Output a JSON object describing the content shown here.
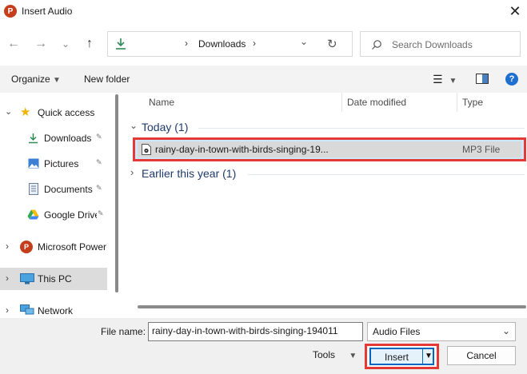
{
  "window": {
    "title": "Insert Audio",
    "app_icon_letter": "P",
    "close_glyph": "✕"
  },
  "nav": {
    "back_glyph": "←",
    "forward_glyph": "→",
    "recent_glyph": "⌄",
    "up_glyph": "↑",
    "breadcrumb_sep": "›",
    "location": "Downloads",
    "location_sep_after": "›",
    "dropdown_glyph": "⌄",
    "refresh_glyph": "↻",
    "search_placeholder": "Search Downloads"
  },
  "toolbar": {
    "organize_label": "Organize",
    "new_folder_label": "New folder",
    "view_glyph": "☰",
    "help_glyph": "?"
  },
  "sidebar": {
    "items": [
      {
        "label": "Quick access",
        "icon": "star-icon",
        "expander": "⌄"
      },
      {
        "label": "Downloads",
        "icon": "download-icon",
        "pin": "📌"
      },
      {
        "label": "Pictures",
        "icon": "pictures-icon",
        "pin": "📌"
      },
      {
        "label": "Documents",
        "icon": "documents-icon",
        "pin": "📌"
      },
      {
        "label": "Google Drive",
        "icon": "google-drive-icon",
        "pin": "📌"
      },
      {
        "label": "Microsoft Power",
        "icon": "powerpoint-icon",
        "expander": "›"
      },
      {
        "label": "This PC",
        "icon": "this-pc-icon",
        "expander": "›"
      },
      {
        "label": "Network",
        "icon": "network-icon",
        "expander": "›"
      }
    ]
  },
  "list": {
    "columns": [
      "Name",
      "Date modified",
      "Type"
    ],
    "groups": [
      {
        "label": "Today (1)",
        "expander": "⌄"
      },
      {
        "label": "Earlier this year (1)",
        "expander": "›"
      }
    ],
    "files": [
      {
        "name": "rainy-day-in-town-with-birds-singing-19...",
        "type": "MP3 File"
      }
    ]
  },
  "bottom": {
    "file_name_label": "File name:",
    "file_name_value": "rainy-day-in-town-with-birds-singing-194011",
    "filter_value": "Audio Files",
    "tools_label": "Tools",
    "insert_label": "Insert",
    "cancel_label": "Cancel"
  },
  "colors": {
    "highlight_border": "#e53935",
    "primary_button_border": "#0067c0",
    "download_green": "#2e8b57"
  }
}
